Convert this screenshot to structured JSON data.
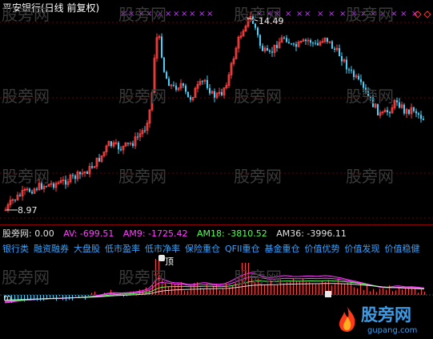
{
  "window": {
    "title": "平安银行(日线 前复权)"
  },
  "watermark": "股旁网",
  "price_panel": {
    "high_label": "14.49",
    "low_label": "8.97"
  },
  "indicator_panel": {
    "name": "股旁网",
    "value_main": ": 0.00",
    "av": "AV: -699.51",
    "am9": "AM9: -1725.42",
    "am18": "AM18: -3810.52",
    "am36": "AM36: -3996.11",
    "categories": [
      "银行类",
      "融资融券",
      "大盘股",
      "低市盈率",
      "低市净率",
      "保险重仓",
      "QFII重仓",
      "基金重仓",
      "价值优势",
      "价值发现",
      "价值稳健"
    ],
    "top_tag": "顶",
    "left_tag": "m"
  },
  "logo": {
    "text": "股旁网",
    "url": "gupang.com"
  },
  "colors": {
    "up": "#ff4040",
    "down": "#3fd4ff",
    "av": "#ff3fff",
    "am9": "#ff3fff",
    "am18": "#54ff54",
    "am36": "#e0e0e0",
    "category": "#3aa3ff",
    "marker": "#c83cff"
  }
}
